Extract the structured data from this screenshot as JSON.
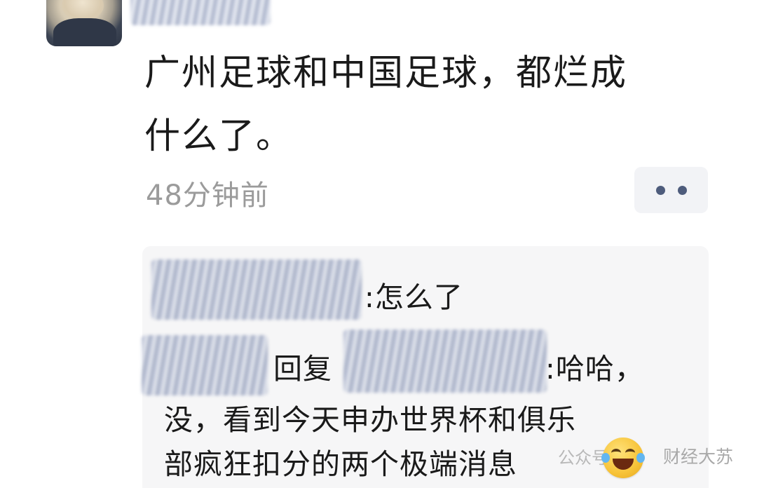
{
  "post": {
    "line1": "广州足球和中国足球，都烂成",
    "line2": "什么了。",
    "time": "48分钟前"
  },
  "comments": {
    "first": {
      "text": ":怎么了"
    },
    "second": {
      "reply_label": "回复",
      "text_line1": ":哈哈，",
      "text_line2": "没，看到今天申办世界杯和俱乐",
      "text_line3": "部疯狂扣分的两个极端消息"
    }
  },
  "watermark": {
    "text": "财经大苏",
    "logo_text": "公众号"
  },
  "icons": {
    "more": "more-dots-icon",
    "emoji": "laughing-tears-emoji-icon"
  },
  "colors": {
    "text": "#1a1a1a",
    "meta": "#9b9b9b",
    "comment_bg": "#f6f6f7",
    "more_bg": "#f2f3f6",
    "dot": "#4e5c7c"
  }
}
